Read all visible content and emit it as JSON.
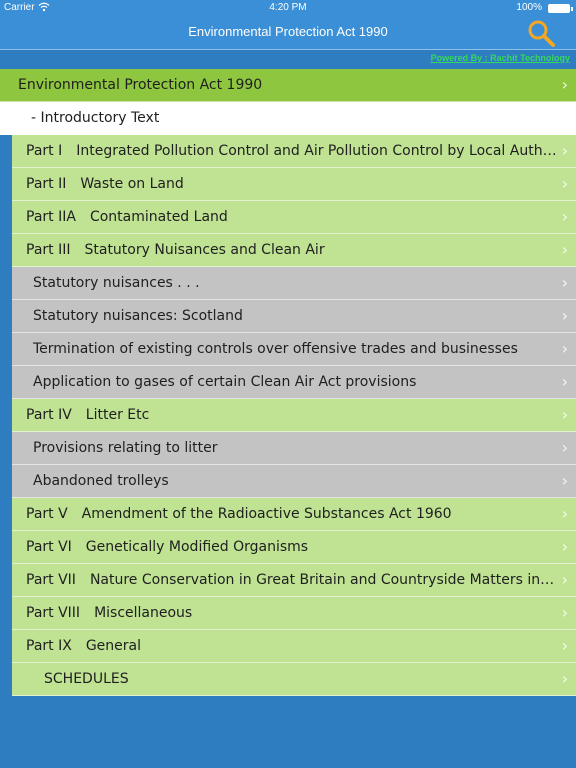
{
  "status_bar": {
    "carrier": "Carrier",
    "time": "4:20 PM",
    "battery": "100%"
  },
  "nav": {
    "title": "Environmental Protection Act 1990",
    "powered_by": "Powered By : Rachit Technology"
  },
  "colors": {
    "nav_blue": "#3a8fd6",
    "background_blue": "#2f7dc1",
    "title_green": "#8ec63f",
    "part_green": "#bfe293",
    "section_gray": "#c3c3c3",
    "search_icon": "#f5a623",
    "link_green": "#34d85a"
  },
  "list": {
    "title": "Environmental Protection Act 1990",
    "intro": "- Introductory Text",
    "rows": [
      {
        "kind": "part",
        "num": "Part I",
        "label": "Integrated Pollution Control and Air Pollution Control by Local Auth…"
      },
      {
        "kind": "part",
        "num": "Part II",
        "label": "Waste on Land"
      },
      {
        "kind": "part",
        "num": "Part IIA",
        "label": "Contaminated Land"
      },
      {
        "kind": "part",
        "num": "Part III",
        "label": "Statutory Nuisances and Clean Air"
      },
      {
        "kind": "section",
        "label": "Statutory nuisances . . ."
      },
      {
        "kind": "section",
        "label": "Statutory nuisances: Scotland"
      },
      {
        "kind": "section",
        "label": "Termination of existing controls over offensive trades and businesses"
      },
      {
        "kind": "section",
        "label": "Application to gases of certain Clean Air Act provisions"
      },
      {
        "kind": "part",
        "num": "Part IV",
        "label": "Litter Etc"
      },
      {
        "kind": "section",
        "label": "Provisions relating to litter"
      },
      {
        "kind": "section",
        "label": "Abandoned trolleys"
      },
      {
        "kind": "part",
        "num": "Part V",
        "label": "Amendment of the Radioactive Substances Act 1960"
      },
      {
        "kind": "part",
        "num": "Part VI",
        "label": "Genetically Modified Organisms"
      },
      {
        "kind": "part",
        "num": "Part VII",
        "label": "Nature Conservation in Great Britain and Countryside Matters in…"
      },
      {
        "kind": "part",
        "num": "Part VIII",
        "label": "Miscellaneous"
      },
      {
        "kind": "part",
        "num": "Part IX",
        "label": "General"
      },
      {
        "kind": "sched",
        "label": "SCHEDULES"
      }
    ]
  },
  "icons": {
    "search": "search-icon",
    "chevron": "chevron-right-icon",
    "wifi": "wifi-icon",
    "battery": "battery-icon"
  }
}
